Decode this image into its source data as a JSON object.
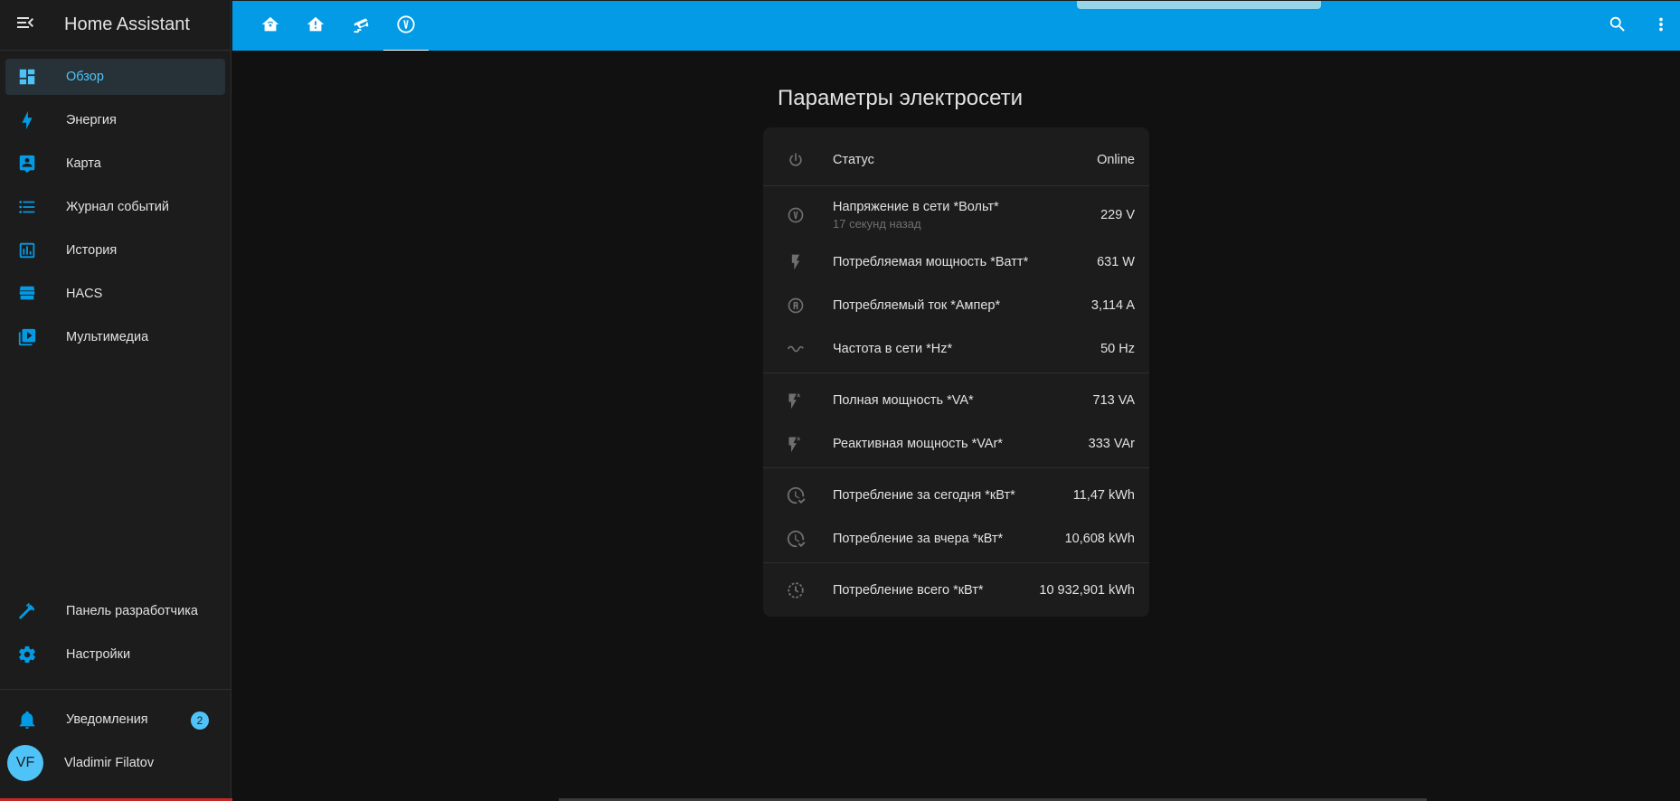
{
  "app": {
    "title": "Home Assistant"
  },
  "sidebar": {
    "items": [
      {
        "label": "Обзор",
        "icon": "dashboard-icon",
        "active": true
      },
      {
        "label": "Энергия",
        "icon": "lightning-bolt-icon"
      },
      {
        "label": "Карта",
        "icon": "map-account-icon"
      },
      {
        "label": "Журнал событий",
        "icon": "format-list-icon"
      },
      {
        "label": "История",
        "icon": "chart-box-icon"
      },
      {
        "label": "HACS",
        "icon": "hacs-icon"
      },
      {
        "label": "Мультимедиа",
        "icon": "play-box-multiple-icon"
      }
    ],
    "bottom_items": [
      {
        "label": "Панель разработчика",
        "icon": "hammer-icon"
      },
      {
        "label": "Настройки",
        "icon": "cog-icon"
      }
    ],
    "notifications": {
      "label": "Уведомления",
      "count": "2",
      "icon": "bell-icon"
    },
    "user": {
      "name": "Vladimir Filatov",
      "initials": "VF"
    }
  },
  "topbar": {
    "tabs": [
      {
        "icon": "home-automation-icon"
      },
      {
        "icon": "home-lightbulb-icon"
      },
      {
        "icon": "cctv-icon"
      },
      {
        "icon": "alpha-v-circle-icon",
        "active": true
      }
    ],
    "search_icon": "magnify-icon",
    "menu_icon": "dots-vertical-icon"
  },
  "main": {
    "title": "Параметры электросети",
    "entities": [
      {
        "name": "Статус",
        "value": "Online",
        "icon": "power-icon"
      },
      {
        "name": "Напряжение в сети *Вольт*",
        "secondary": "17 секунд назад",
        "value": "229 V",
        "icon": "alpha-v-circle-outline-icon"
      },
      {
        "name": "Потребляемая мощность *Ватт*",
        "value": "631 W",
        "icon": "flash-icon"
      },
      {
        "name": "Потребляемый ток *Ампер*",
        "value": "3,114 A",
        "icon": "alpha-a-circle-outline-icon"
      },
      {
        "name": "Частота в сети *Hz*",
        "value": "50 Hz",
        "icon": "sine-wave-icon"
      },
      {
        "name": "Полная мощность *VA*",
        "value": "713 VA",
        "icon": "flash-a-icon"
      },
      {
        "name": "Реактивная мощность *VAr*",
        "value": "333 VAr",
        "icon": "flash-a-icon"
      },
      {
        "name": "Потребление за сегодня *кВт*",
        "value": "11,47 kWh",
        "icon": "clock-check-outline-icon"
      },
      {
        "name": "Потребление за вчера *кВт*",
        "value": "10,608 kWh",
        "icon": "clock-check-outline-icon"
      },
      {
        "name": "Потребление всего *кВт*",
        "value": "10 932,901 kWh",
        "icon": "history-icon"
      }
    ]
  },
  "colors": {
    "accent": "#039be5",
    "active_text": "#4fc3f7",
    "sidebar_bg": "#1c1c1c",
    "page_bg": "#111111"
  }
}
